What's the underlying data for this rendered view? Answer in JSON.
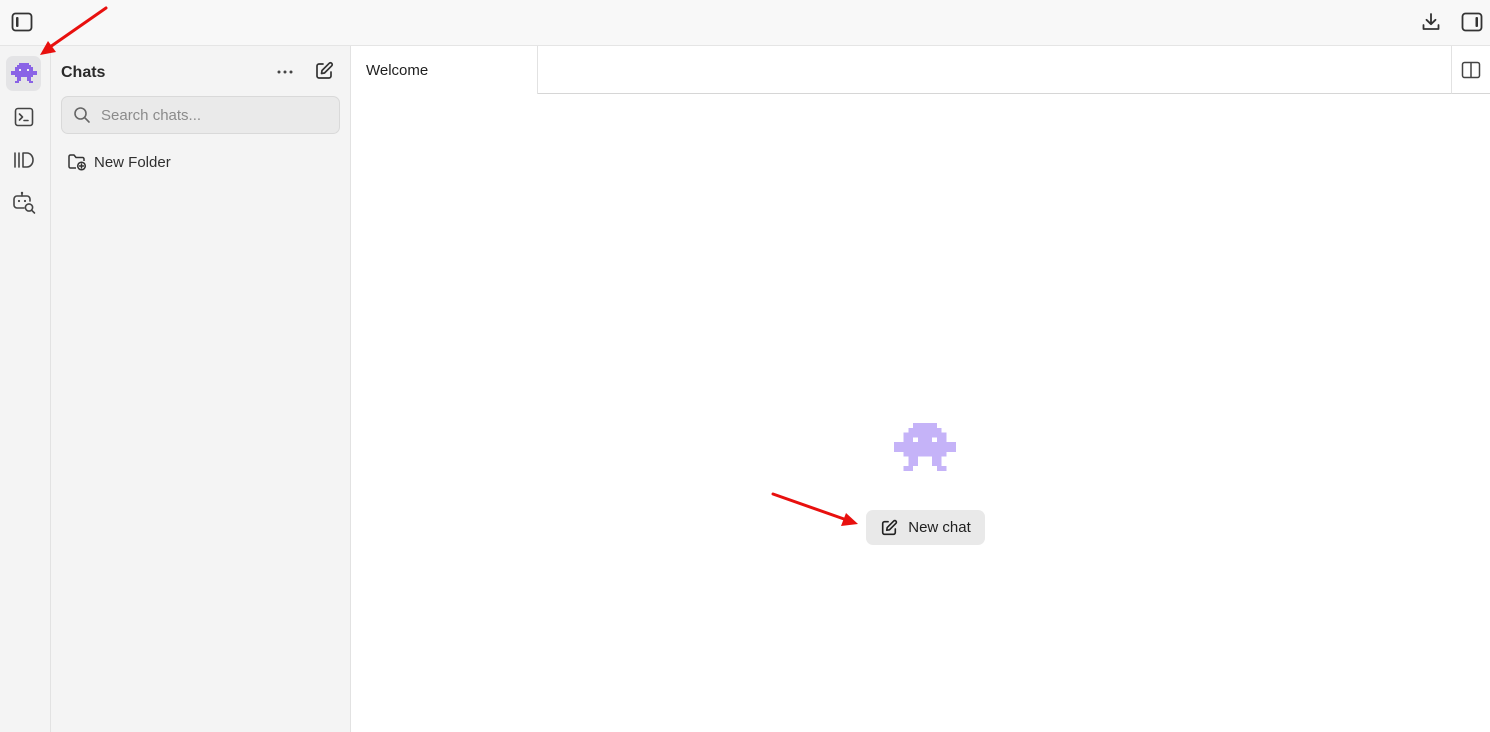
{
  "sidebar": {
    "title": "Chats",
    "search_placeholder": "Search chats...",
    "folders": [
      {
        "label": "New Folder"
      }
    ]
  },
  "tabs": [
    {
      "label": "Welcome"
    }
  ],
  "welcome": {
    "new_chat_label": "New chat"
  },
  "rail": {
    "items": [
      {
        "icon": "space-invader-icon",
        "active": true
      },
      {
        "icon": "terminal-icon"
      },
      {
        "icon": "library-icon"
      },
      {
        "icon": "bot-search-icon"
      }
    ]
  },
  "colors": {
    "accent_purple": "#a58af0",
    "annotation_red": "#e8100e"
  }
}
